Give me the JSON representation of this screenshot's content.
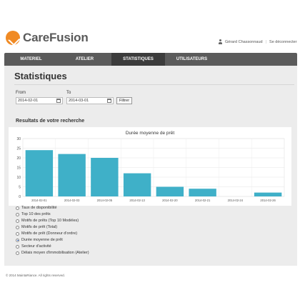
{
  "header": {
    "brand": "CareFusion",
    "user_name": "Gérard Chassonnaud",
    "logout_label": "Se déconnecter"
  },
  "nav": [
    {
      "label": "MATERIEL",
      "active": false
    },
    {
      "label": "ATELIER",
      "active": false
    },
    {
      "label": "STATISTIQUES",
      "active": true
    },
    {
      "label": "UTILISATEURS",
      "active": false
    }
  ],
  "page": {
    "title": "Statistiques"
  },
  "filters": {
    "from_label": "From",
    "from_value": "2014-02-01",
    "to_label": "To",
    "to_value": "2014-03-01",
    "submit_label": "Filtrer"
  },
  "results": {
    "title": "Resultats de votre recherche"
  },
  "chart_data": {
    "type": "bar",
    "title": "Durée moyenne de prêt",
    "categories": [
      "2014-02-01",
      "2014-02-03",
      "2014-02-05",
      "2014-02-13",
      "2014-02-20",
      "2014-02-21",
      "2014-02-24",
      "2014-02-26"
    ],
    "values": [
      24,
      22,
      20,
      12,
      5,
      4,
      0,
      2
    ],
    "ylim": [
      0,
      30
    ],
    "yticks": [
      0,
      5,
      10,
      15,
      20,
      25,
      30
    ],
    "grid": true,
    "bar_color": "#3fb0c8"
  },
  "options": [
    {
      "label": "Taux de disponibilité",
      "selected": false
    },
    {
      "label": "Top 10 des prêts",
      "selected": false
    },
    {
      "label": "Motifs de prêts (Top 10 Modèles)",
      "selected": false
    },
    {
      "label": "Motifs de prêt (Total)",
      "selected": false
    },
    {
      "label": "Motifs de prêt (Donneur d'ordre)",
      "selected": false
    },
    {
      "label": "Durée moyenne de prêt",
      "selected": true
    },
    {
      "label": "Secteur d'activité",
      "selected": false
    },
    {
      "label": "Délais moyen d'immobilisation (Atelier)",
      "selected": false
    }
  ],
  "footer": {
    "text": "© 2014 MaintaRiance. All rights reserved."
  },
  "colors": {
    "nav_bg": "#5b5b5b",
    "nav_active": "#3c3c3c",
    "panel_bg": "#ececec",
    "logo": "#f08a24"
  },
  "icons": {
    "logo": "carefusion-logo-icon",
    "user": "user-icon",
    "calendar": "calendar-icon"
  }
}
